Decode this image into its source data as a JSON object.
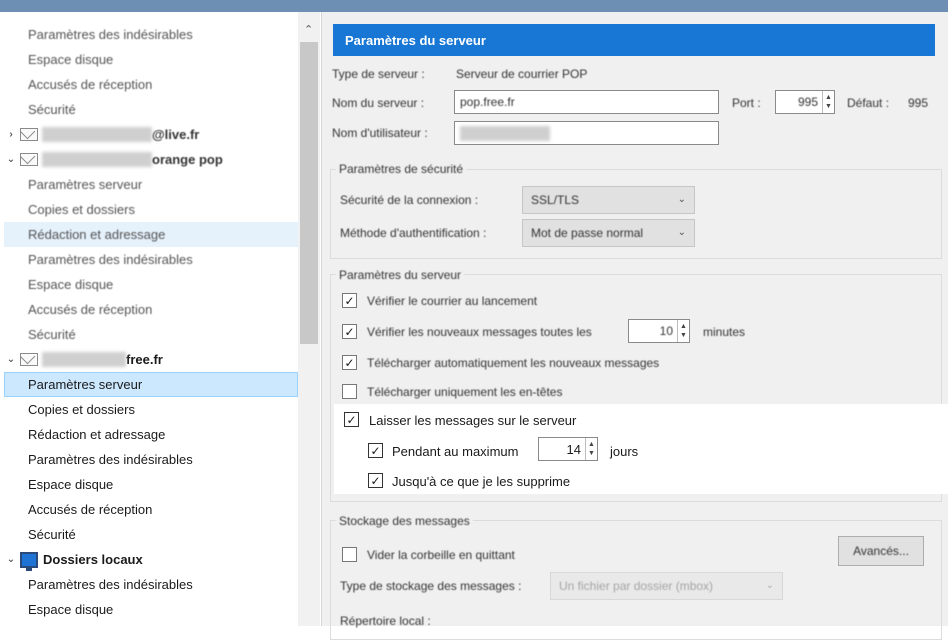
{
  "tree": {
    "items": [
      {
        "label": "Paramètres des indésirables",
        "kind": "item",
        "blur": true
      },
      {
        "label": "Espace disque",
        "kind": "item",
        "blur": true
      },
      {
        "label": "Accusés de réception",
        "kind": "item",
        "blur": true
      },
      {
        "label": "Sécurité",
        "kind": "item",
        "blur": true
      },
      {
        "label": "@live.fr",
        "kind": "account",
        "twisty": "›",
        "blur": true
      },
      {
        "label": "orange pop",
        "kind": "account",
        "twisty": "⌄",
        "blur": true
      },
      {
        "label": "Paramètres serveur",
        "kind": "item",
        "blur": true
      },
      {
        "label": "Copies et dossiers",
        "kind": "item",
        "blur": true
      },
      {
        "label": "Rédaction et adressage",
        "kind": "item",
        "blur": true,
        "highlight": true
      },
      {
        "label": "Paramètres des indésirables",
        "kind": "item",
        "blur": true
      },
      {
        "label": "Espace disque",
        "kind": "item",
        "blur": true
      },
      {
        "label": "Accusés de réception",
        "kind": "item",
        "blur": true
      },
      {
        "label": "Sécurité",
        "kind": "item",
        "blur": true
      },
      {
        "label": "free.fr",
        "kind": "account",
        "twisty": "⌄",
        "blur": false
      },
      {
        "label": "Paramètres serveur",
        "kind": "item",
        "selected": true
      },
      {
        "label": "Copies et dossiers",
        "kind": "item"
      },
      {
        "label": "Rédaction et adressage",
        "kind": "item"
      },
      {
        "label": "Paramètres des indésirables",
        "kind": "item"
      },
      {
        "label": "Espace disque",
        "kind": "item"
      },
      {
        "label": "Accusés de réception",
        "kind": "item"
      },
      {
        "label": "Sécurité",
        "kind": "item"
      },
      {
        "label": "Dossiers locaux",
        "kind": "local",
        "twisty": "⌄"
      },
      {
        "label": "Paramètres des indésirables",
        "kind": "item"
      },
      {
        "label": "Espace disque",
        "kind": "item"
      }
    ]
  },
  "panel": {
    "header": "Paramètres du serveur",
    "server_type_label": "Type de serveur :",
    "server_type_value": "Serveur de courrier POP",
    "server_name_label": "Nom du serveur :",
    "server_name_value": "pop.free.fr",
    "port_label": "Port :",
    "port_value": "995",
    "default_label": "Défaut :",
    "default_value": "995",
    "username_label": "Nom d'utilisateur :",
    "security": {
      "title": "Paramètres de sécurité",
      "connection_label": "Sécurité de la connexion :",
      "connection_value": "SSL/TLS",
      "auth_label": "Méthode d'authentification :",
      "auth_value": "Mot de passe normal"
    },
    "server_settings": {
      "title": "Paramètres du serveur",
      "check_on_start": "Vérifier le courrier au lancement",
      "check_every": "Vérifier les nouveaux messages toutes les",
      "check_every_value": "10",
      "minutes": "minutes",
      "auto_download": "Télécharger automatiquement les nouveaux messages",
      "headers_only": "Télécharger uniquement les en-têtes",
      "leave_on_server": "Laisser les messages sur le serveur",
      "for_max": "Pendant au maximum",
      "for_max_value": "14",
      "days": "jours",
      "until_deleted": "Jusqu'à ce que je les supprime"
    },
    "storage": {
      "title": "Stockage des messages",
      "empty_trash": "Vider la corbeille en quittant",
      "advanced_button": "Avancés...",
      "storage_type_label": "Type de stockage des messages :",
      "storage_type_value": "Un fichier par dossier (mbox)",
      "local_dir_label": "Répertoire local :"
    }
  },
  "icons": {
    "check": "✓",
    "chevron_down": "⌄",
    "scroll_up": "⌃",
    "spin_up": "▲",
    "spin_down": "▼"
  },
  "colors": {
    "header": "#1877d4",
    "selection": "#cce8ff",
    "hover": "#e5f1fb",
    "titlebar": "#6c8fb3"
  }
}
